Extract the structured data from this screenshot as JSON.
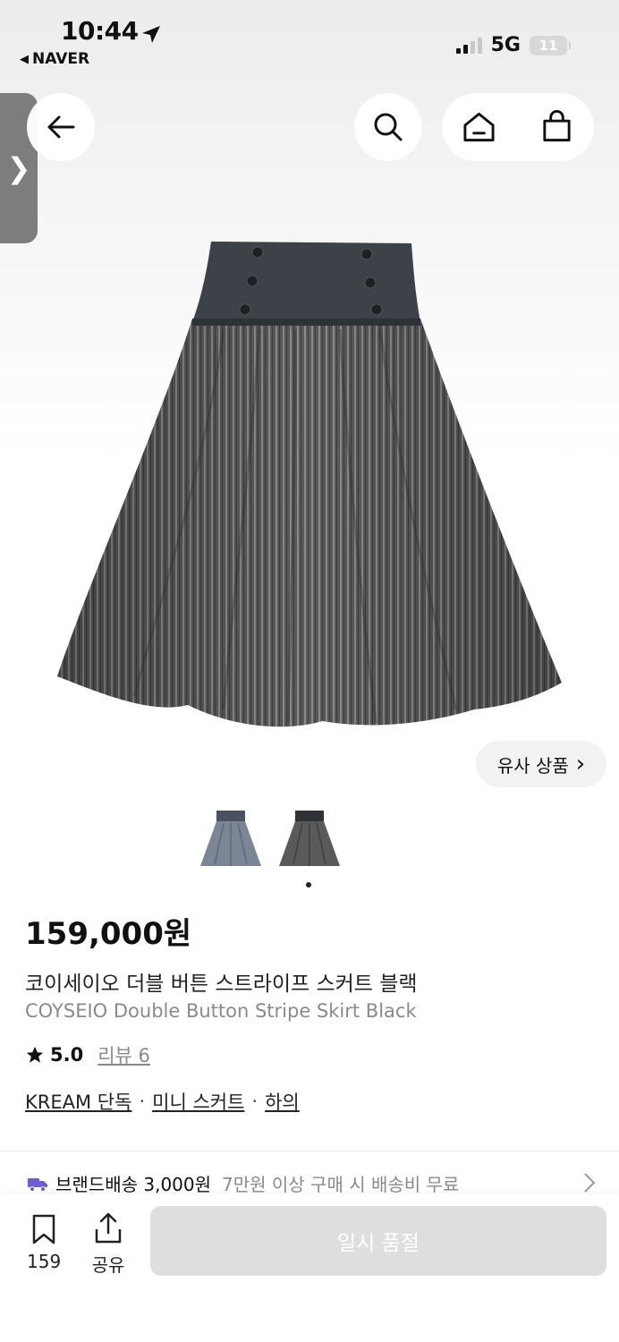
{
  "status_bar": {
    "time": "10:44",
    "back_app": "NAVER",
    "network": "5G",
    "battery": "11"
  },
  "header": {
    "side_tab_glyph": "❯"
  },
  "similar_button": {
    "label": "유사 상품",
    "chevron": "›"
  },
  "gallery": {
    "selected_index": 1,
    "thumbnail_count": 2
  },
  "product": {
    "price": "159,000원",
    "name_ko": "코이세이오 더블 버튼 스트라이프 스커트 블랙",
    "name_en": "COYSEIO Double Button Stripe Skirt Black",
    "rating": "5.0",
    "review_label": "리뷰 6",
    "categories": [
      "KREAM 단독",
      "미니 스커트",
      "하의"
    ],
    "separator": "·"
  },
  "shipping": {
    "label": "브랜드배송 3,000원",
    "condition": "7만원 이상 구매 시 배송비 무료"
  },
  "bottom_bar": {
    "bookmark_count": "159",
    "share_label": "공유",
    "buy_label": "일시 품절"
  },
  "colors": {
    "side_tab": "#7d7d7d",
    "soldout_bg": "#dedede",
    "shipping_truck": "#6f5bd8"
  }
}
